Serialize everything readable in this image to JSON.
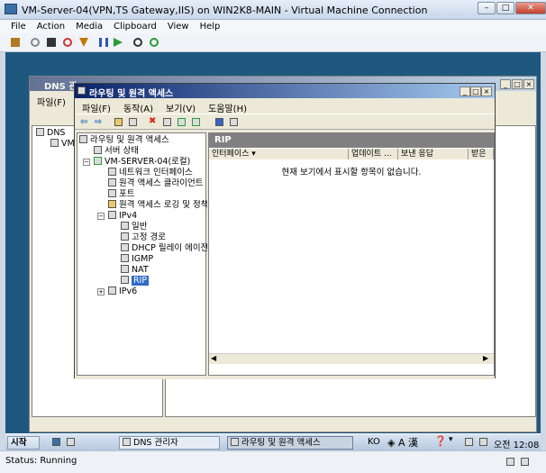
{
  "host": {
    "title": "VM-Server-04(VPN,TS Gateway,IIS) on WIN2K8-MAIN - Virtual Machine Connection",
    "menu": [
      "File",
      "Action",
      "Media",
      "Clipboard",
      "View",
      "Help"
    ],
    "status": "Status: Running"
  },
  "dns": {
    "title": "DNS 관",
    "menu_file": "파일(F)",
    "tree": [
      "DNS",
      "VM"
    ]
  },
  "rras": {
    "title": "라우팅 및 원격 액세스",
    "menu": [
      "파일(F)",
      "동작(A)",
      "보기(V)",
      "도움말(H)"
    ],
    "tree": {
      "root": "라우팅 및 원격 액세스",
      "server_status": "서버 상태",
      "server": "VM-SERVER-04(로컬)",
      "items": [
        "네트워크 인터페이스",
        "원격 액세스 클라이언트",
        "포트",
        "원격 액세스 로깅 및 정책"
      ],
      "ipv4": "IPv4",
      "ipv4_items": [
        "일반",
        "고정 경로",
        "DHCP 릴레이 에이전",
        "IGMP",
        "NAT",
        "RIP"
      ],
      "ipv6": "IPv6"
    },
    "panel_title": "RIP",
    "columns": [
      "인터페이스",
      "업데이트 ...",
      "보낸 응답",
      "받은"
    ],
    "empty": "현재 보기에서 표시할 항목이 없습니다."
  },
  "taskbar": {
    "start": "시작",
    "tasks": [
      "DNS 관리자",
      "라우팅 및 원격 액세스"
    ],
    "lang": "KO",
    "clock": "오전 12:08"
  }
}
